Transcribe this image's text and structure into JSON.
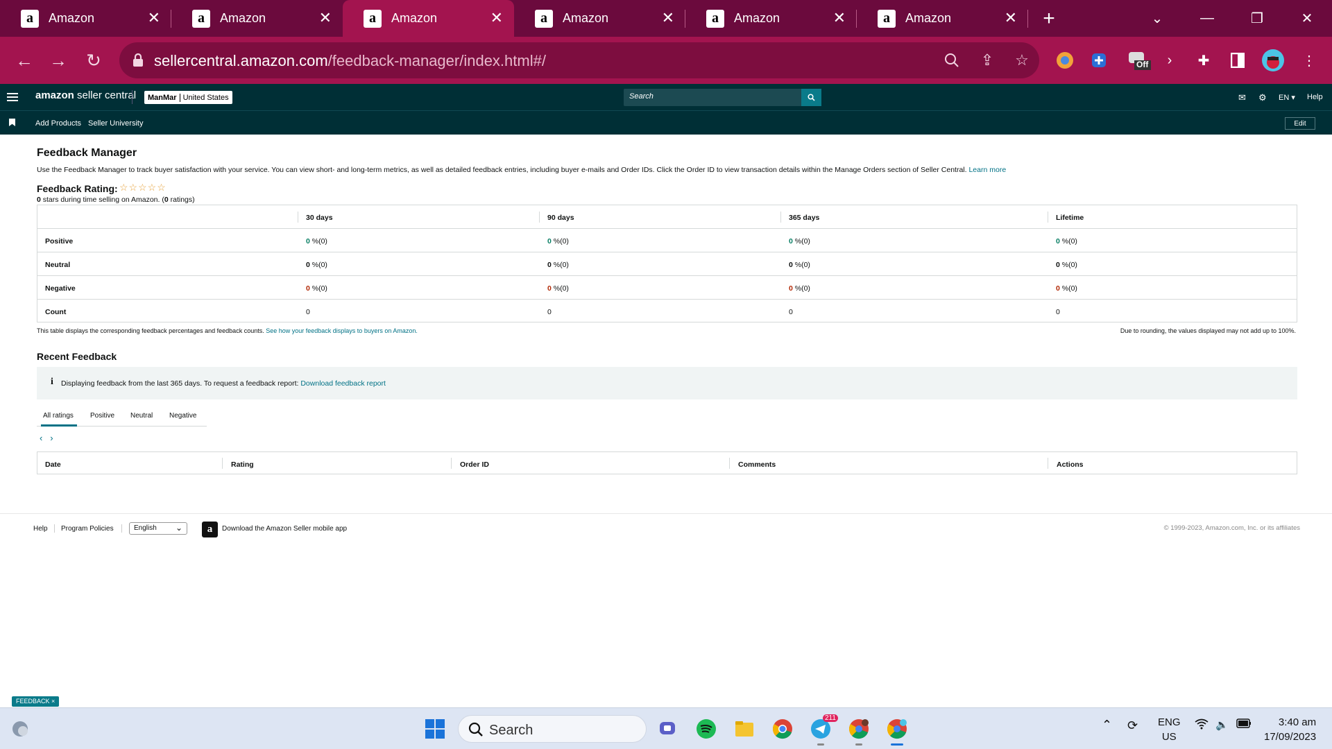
{
  "browser": {
    "tabs": [
      {
        "title": "Amazon",
        "active": false
      },
      {
        "title": "Amazon",
        "active": false
      },
      {
        "title": "Amazon",
        "active": true
      },
      {
        "title": "Amazon",
        "active": false
      },
      {
        "title": "Amazon",
        "active": false
      },
      {
        "title": "Amazon",
        "active": false
      }
    ],
    "url_host": "sellercentral.amazon.com",
    "url_path": "/feedback-manager/index.html#/",
    "ext_off_label": "Off"
  },
  "header": {
    "logo_bold": "amazon",
    "logo_rest": " seller central",
    "account_name": "ManMar",
    "account_region": "United States",
    "search_placeholder": "Search",
    "lang": "EN ▾",
    "help": "Help"
  },
  "nav": {
    "links": [
      "Add Products",
      "Seller University"
    ],
    "edit": "Edit"
  },
  "page": {
    "title": "Feedback Manager",
    "intro": "Use the Feedback Manager to track buyer satisfaction with your service. You can view short- and long-term metrics, as well as detailed feedback entries, including buyer e-mails and Order IDs. Click the Order ID to view transaction details within the Manage Orders section of Seller Central.",
    "learn_more": "Learn more",
    "rating_label": "Feedback Rating:",
    "stars": "☆☆☆☆☆",
    "rating_sub_count": "0",
    "rating_sub_mid": " stars during time selling on Amazon. (",
    "rating_sub_num": "0",
    "rating_sub_end": " ratings)",
    "table": {
      "columns": [
        "30 days",
        "90 days",
        "365 days",
        "Lifetime"
      ],
      "rows": [
        {
          "label": "Positive",
          "values": [
            "0",
            "0",
            "0",
            "0"
          ],
          "suffix": " %(0)"
        },
        {
          "label": "Neutral",
          "values": [
            "0",
            "0",
            "0",
            "0"
          ],
          "suffix": " %(0)"
        },
        {
          "label": "Negative",
          "values": [
            "0",
            "0",
            "0",
            "0"
          ],
          "suffix": " %(0)"
        },
        {
          "label": "Count",
          "values": [
            "0",
            "0",
            "0",
            "0"
          ],
          "suffix": ""
        }
      ]
    },
    "table_note": "This table displays the corresponding feedback percentages and feedback counts.",
    "table_note_link": "See how your feedback displays to buyers on Amazon.",
    "rounding_note": "Due to rounding, the values displayed may not add up to 100%.",
    "recent_title": "Recent Feedback",
    "info_text": "Displaying feedback from the last 365 days. To request a feedback report:",
    "info_link": "Download feedback report",
    "tabs": [
      "All ratings",
      "Positive",
      "Neutral",
      "Negative"
    ],
    "recent_columns": [
      "Date",
      "Rating",
      "Order ID",
      "Comments",
      "Actions"
    ]
  },
  "footer": {
    "help": "Help",
    "policies": "Program Policies",
    "language": "English",
    "app_text": "Download the Amazon Seller mobile app",
    "copyright": "© 1999-2023, Amazon.com, Inc. or its affiliates"
  },
  "feedback_badge": "FEEDBACK ×",
  "taskbar": {
    "search": "Search",
    "telegram_badge": "211",
    "lang_top": "ENG",
    "lang_bottom": "US",
    "time": "3:40 am",
    "date": "17/09/2023"
  }
}
